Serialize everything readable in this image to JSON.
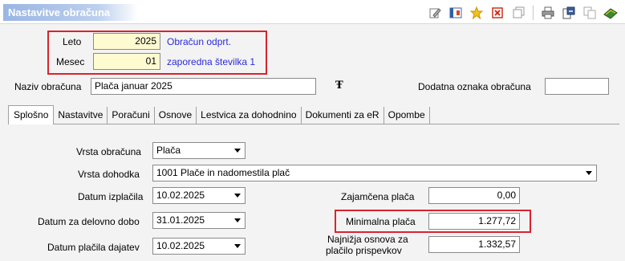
{
  "window": {
    "title": "Nastavitve obračuna"
  },
  "toolbar": {
    "icons": [
      "edit-icon",
      "columns-icon",
      "star-icon",
      "delete-icon",
      "window-icon",
      "print-icon",
      "export-icon",
      "copy-icon",
      "book-icon"
    ]
  },
  "header": {
    "leto_label": "Leto",
    "leto_value": "2025",
    "obracun_note": "Obračun odprt.",
    "mesec_label": "Mesec",
    "mesec_value": "01",
    "zaporedna_note": "zaporedna številka 1",
    "naziv_label": "Naziv obračuna",
    "naziv_value": "Plača januar 2025",
    "format_icon_glyph": "Ŧ",
    "dodatna_label": "Dodatna oznaka obračuna",
    "dodatna_value": ""
  },
  "tabs": [
    {
      "label": "Splošno",
      "active": true
    },
    {
      "label": "Nastavitve",
      "active": false
    },
    {
      "label": "Poračuni",
      "active": false
    },
    {
      "label": "Osnove",
      "active": false
    },
    {
      "label": "Lestvica za dohodnino",
      "active": false
    },
    {
      "label": "Dokumenti za eR",
      "active": false
    },
    {
      "label": "Opombe",
      "active": false
    }
  ],
  "form": {
    "vrsta_obracuna_label": "Vrsta obračuna",
    "vrsta_obracuna_value": "Plača",
    "vrsta_dohodka_label": "Vrsta dohodka",
    "vrsta_dohodka_value": "1001 Plače in nadomestila plač",
    "datum_izplacila_label": "Datum izplačila",
    "datum_izplacila_value": "10.02.2025",
    "datum_delovno_label": "Datum za delovno dobo",
    "datum_delovno_value": "31.01.2025",
    "datum_dajatev_label": "Datum plačila dajatev",
    "datum_dajatev_value": "10.02.2025",
    "zajamcena_label": "Zajamčena plača",
    "zajamcena_value": "0,00",
    "minimalna_label": "Minimalna plača",
    "minimalna_value": "1.277,72",
    "najnizja_label_1": "Najnižja osnova za",
    "najnizja_label_2": "plačilo prispevkov",
    "najnizja_value": "1.332,57"
  },
  "colors": {
    "highlight_border": "#d9232e",
    "info_text": "#2b2bd9",
    "yellow_field": "#fffbd1"
  }
}
